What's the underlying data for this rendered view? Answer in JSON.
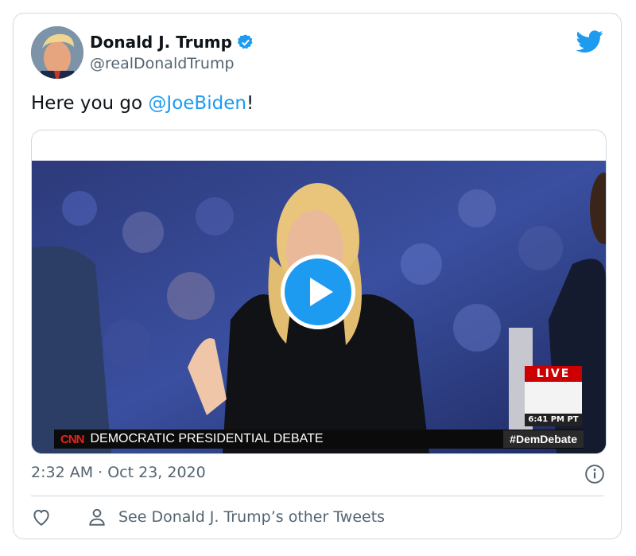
{
  "author": {
    "name": "Donald J. Trump",
    "handle": "@realDonaldTrump"
  },
  "tweet": {
    "text_before": "Here you go ",
    "mention": "@JoeBiden",
    "text_after": "!"
  },
  "video": {
    "network": "CNN",
    "chyron": "DEMOCRATIC PRESIDENTIAL DEBATE",
    "hashtag": "#DemDebate",
    "live_label": "LIVE",
    "clock": "6:41 PM PT"
  },
  "meta": {
    "timestamp": "2:32 AM · Oct 23, 2020",
    "other_tweets_label": "See Donald J. Trump’s other Tweets"
  },
  "colors": {
    "accent": "#1d9bf0",
    "muted_text": "#536471",
    "border": "#cfd9de"
  },
  "icons": [
    "verified-badge-icon",
    "twitter-bird-icon",
    "play-icon",
    "info-icon",
    "heart-icon",
    "person-icon"
  ]
}
